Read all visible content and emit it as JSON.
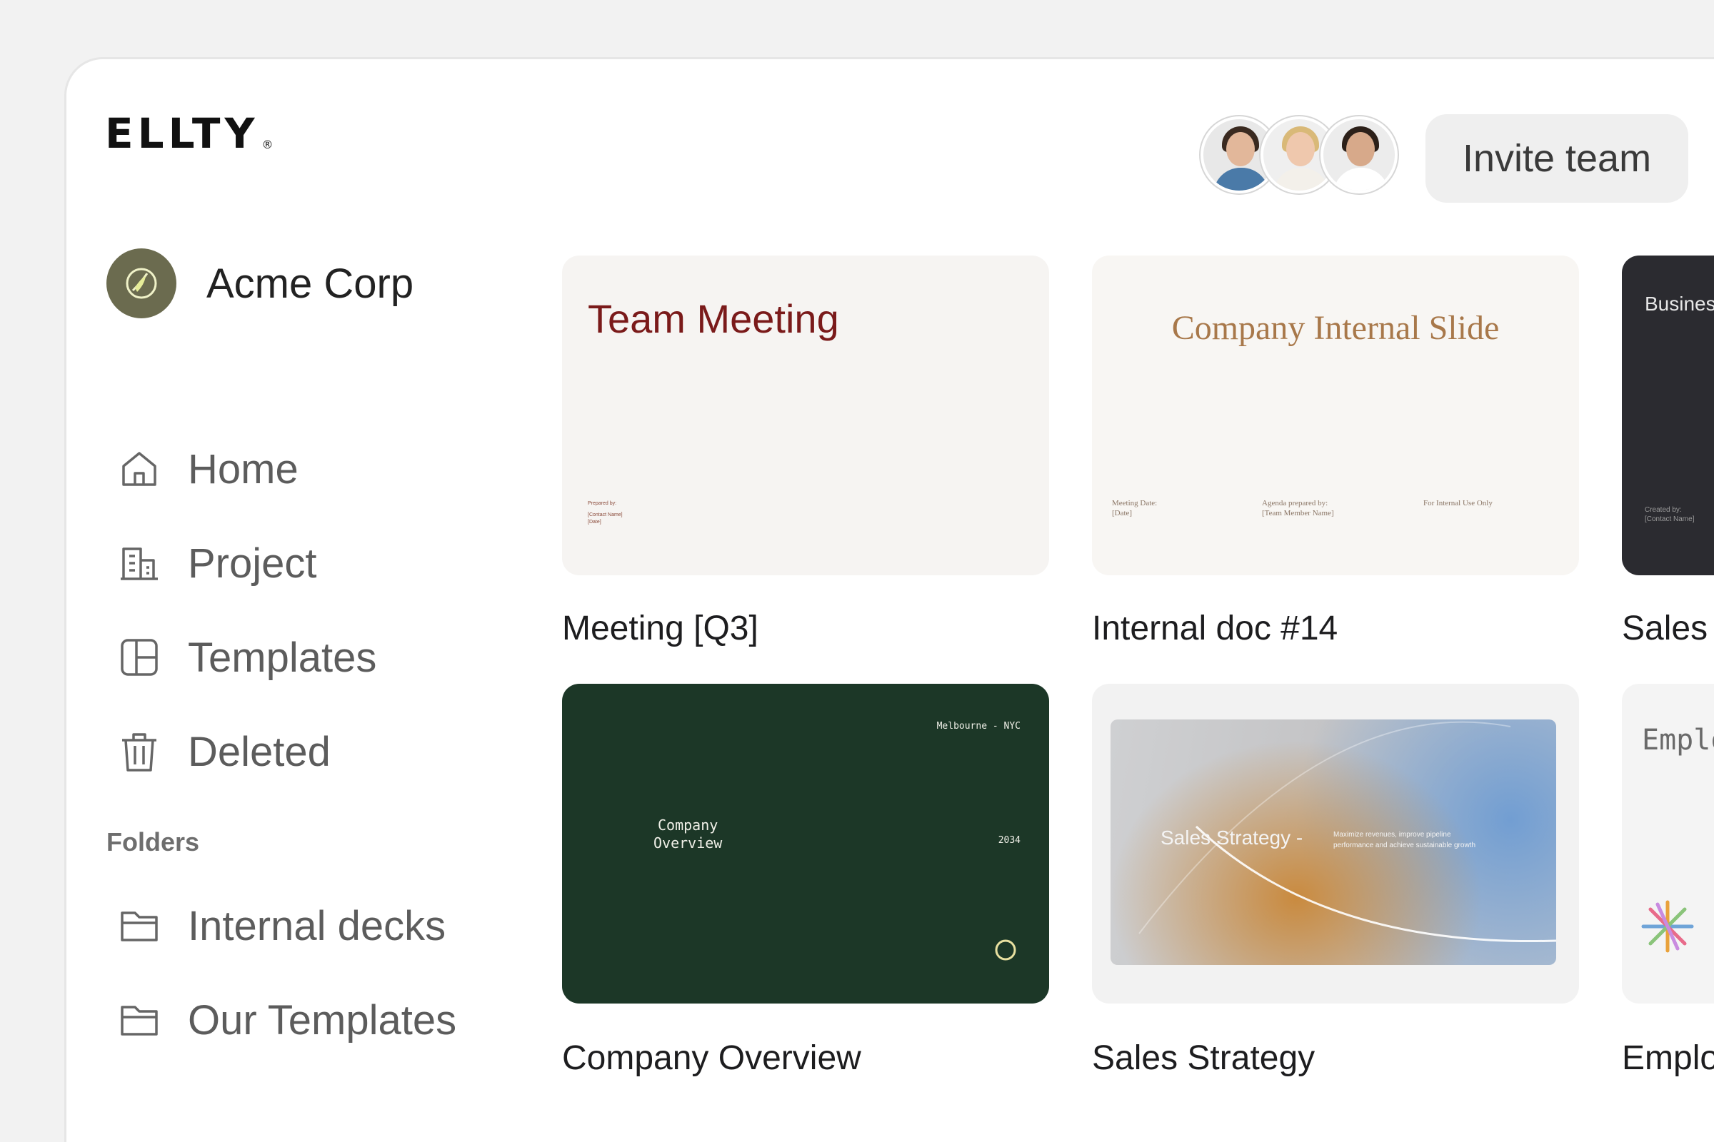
{
  "brand": {
    "logo": "ELLTY",
    "reg_mark": "®"
  },
  "header": {
    "invite_label": "Invite team"
  },
  "workspace": {
    "name": "Acme Corp"
  },
  "nav": [
    {
      "label": "Home",
      "icon": "home-icon"
    },
    {
      "label": "Project",
      "icon": "building-icon"
    },
    {
      "label": "Templates",
      "icon": "layout-icon"
    },
    {
      "label": "Deleted",
      "icon": "trash-icon"
    }
  ],
  "folders": {
    "title": "Folders",
    "items": [
      {
        "label": "Internal decks",
        "icon": "folder-icon"
      },
      {
        "label": "Our Templates",
        "icon": "folder-icon"
      }
    ]
  },
  "cards": [
    {
      "caption": "Meeting [Q3]",
      "title": "Team Meeting",
      "prepared_by": "Prepared by:",
      "contact": "[Contact Name]",
      "date": "[Date]"
    },
    {
      "caption": "Internal doc #14",
      "title": "Company Internal Slide",
      "meeting_date_label": "Meeting Date:",
      "meeting_date_value": "[Date]",
      "agenda_label": "Agenda prepared by:",
      "agenda_value": "[Team Member Name]",
      "internal_note": "For Internal Use Only"
    },
    {
      "caption": "Sales F",
      "title": "Busines",
      "created_by": "Created by:",
      "contact": "[Contact Name]"
    },
    {
      "caption": "Company Overview",
      "location": "Melbourne - NYC",
      "title_line1": "Company",
      "title_line2": "Overview",
      "year": "2034"
    },
    {
      "caption": "Sales Strategy",
      "title": "Sales Strategy  -",
      "desc_line1": "Maximize revenues, improve pipeline",
      "desc_line2": "performance and achieve sustainable growth"
    },
    {
      "caption": "Emplo",
      "title": "Emplo"
    }
  ],
  "colors": {
    "accent_workspace": "#6b6b4f",
    "meeting_title": "#7a1a1a",
    "overview_bg": "#1c3727",
    "internal_title": "#a8784a"
  }
}
